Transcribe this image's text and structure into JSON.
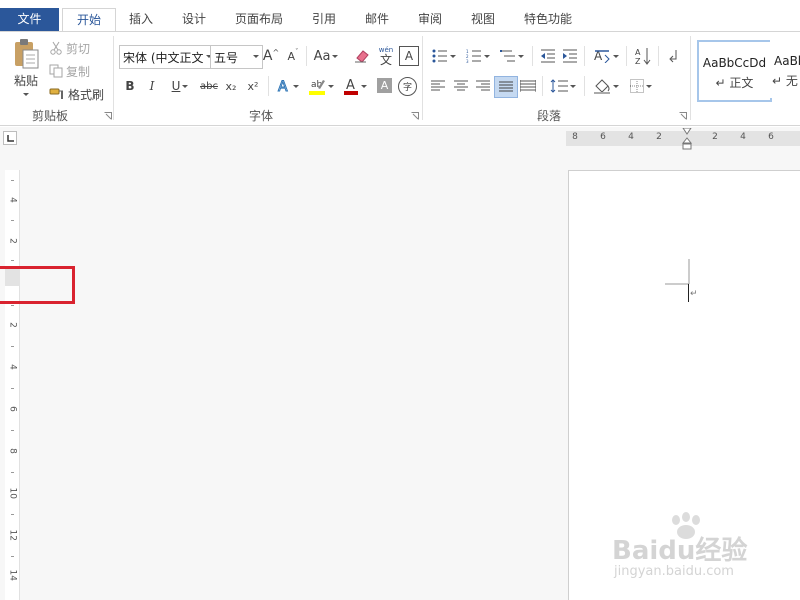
{
  "tabs": {
    "file": "文件",
    "home": "开始",
    "insert": "插入",
    "design": "设计",
    "layout": "页面布局",
    "references": "引用",
    "mailings": "邮件",
    "review": "审阅",
    "view": "视图",
    "features": "特色功能"
  },
  "clipboard": {
    "paste": "粘贴",
    "cut": "剪切",
    "copy": "复制",
    "format_painter": "格式刷",
    "group_label": "剪贴板"
  },
  "font": {
    "name": "宋体 (中文正文",
    "size": "五号",
    "bold": "B",
    "italic": "I",
    "underline": "U",
    "strikethrough": "abc",
    "subscript": "x₂",
    "superscript": "x²",
    "change_case": "Aa",
    "grow": "A",
    "shrink": "A",
    "char_border": "A",
    "char_shading": "A",
    "enclose": "字",
    "phonetic_top": "wén",
    "phonetic_bottom": "文",
    "group_label": "字体"
  },
  "paragraph": {
    "group_label": "段落"
  },
  "styles": {
    "items": [
      {
        "sample": "AaBbCcDd",
        "name": "正文"
      },
      {
        "sample": "AaBl",
        "name": "无"
      }
    ]
  },
  "ruler": {
    "h_labels": [
      "8",
      "6",
      "4",
      "2",
      "2",
      "4",
      "6"
    ],
    "v_labels": [
      "4",
      "2",
      "2",
      "4",
      "6",
      "8",
      "10",
      "12",
      "14"
    ]
  },
  "watermark": {
    "brand": "Baidu经验",
    "url": "jingyan.baidu.com"
  },
  "colors": {
    "accent": "#2b579a",
    "highlight_box": "#d9232f",
    "highlighter": "#ffff00",
    "font_color": "#c00000"
  }
}
